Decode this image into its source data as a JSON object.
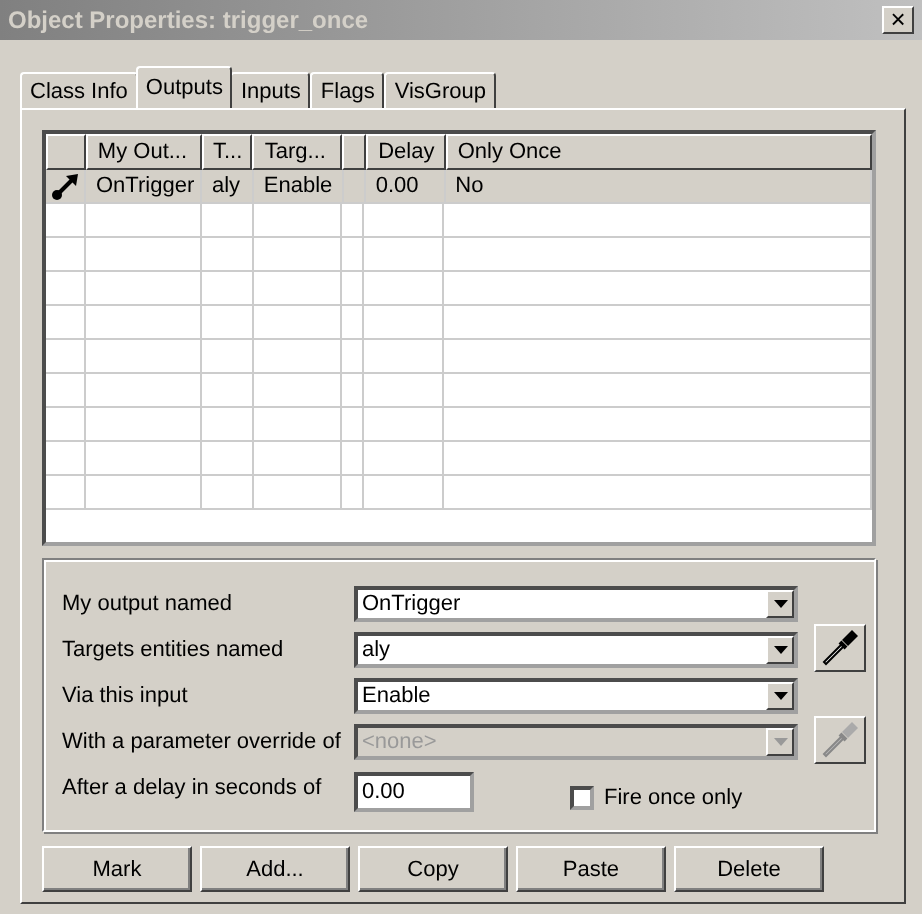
{
  "window": {
    "title": "Object Properties: trigger_once",
    "close": "×"
  },
  "tabs": [
    {
      "label": "Class Info",
      "selected": false
    },
    {
      "label": "Outputs",
      "selected": true
    },
    {
      "label": "Inputs",
      "selected": false
    },
    {
      "label": "Flags",
      "selected": false
    },
    {
      "label": "VisGroup",
      "selected": false
    }
  ],
  "table": {
    "columns": [
      "My Out...",
      "T...",
      "Targ...",
      "",
      "Delay",
      "Only Once"
    ],
    "rows": [
      {
        "cells": [
          "OnTrigger",
          "aly",
          "Enable",
          "",
          "0.00",
          "No"
        ],
        "selected": true
      }
    ]
  },
  "fields": [
    {
      "label": "My output named",
      "kind": "combo",
      "value": "OnTrigger",
      "disabled": false,
      "picker": false
    },
    {
      "label": "Targets entities named",
      "kind": "combo",
      "value": "aly",
      "disabled": false,
      "picker": true
    },
    {
      "label": "Via this input",
      "kind": "combo",
      "value": "Enable",
      "disabled": false,
      "picker": false
    },
    {
      "label": "With a parameter override of",
      "kind": "combo",
      "value": "<none>",
      "disabled": true,
      "picker": true
    },
    {
      "label": "After a delay in seconds of",
      "kind": "text",
      "value": "0.00",
      "disabled": false,
      "picker": false
    }
  ],
  "fire_once": {
    "label": "Fire once only",
    "checked": false
  },
  "buttons": [
    "Mark",
    "Add...",
    "Copy",
    "Paste",
    "Delete"
  ]
}
